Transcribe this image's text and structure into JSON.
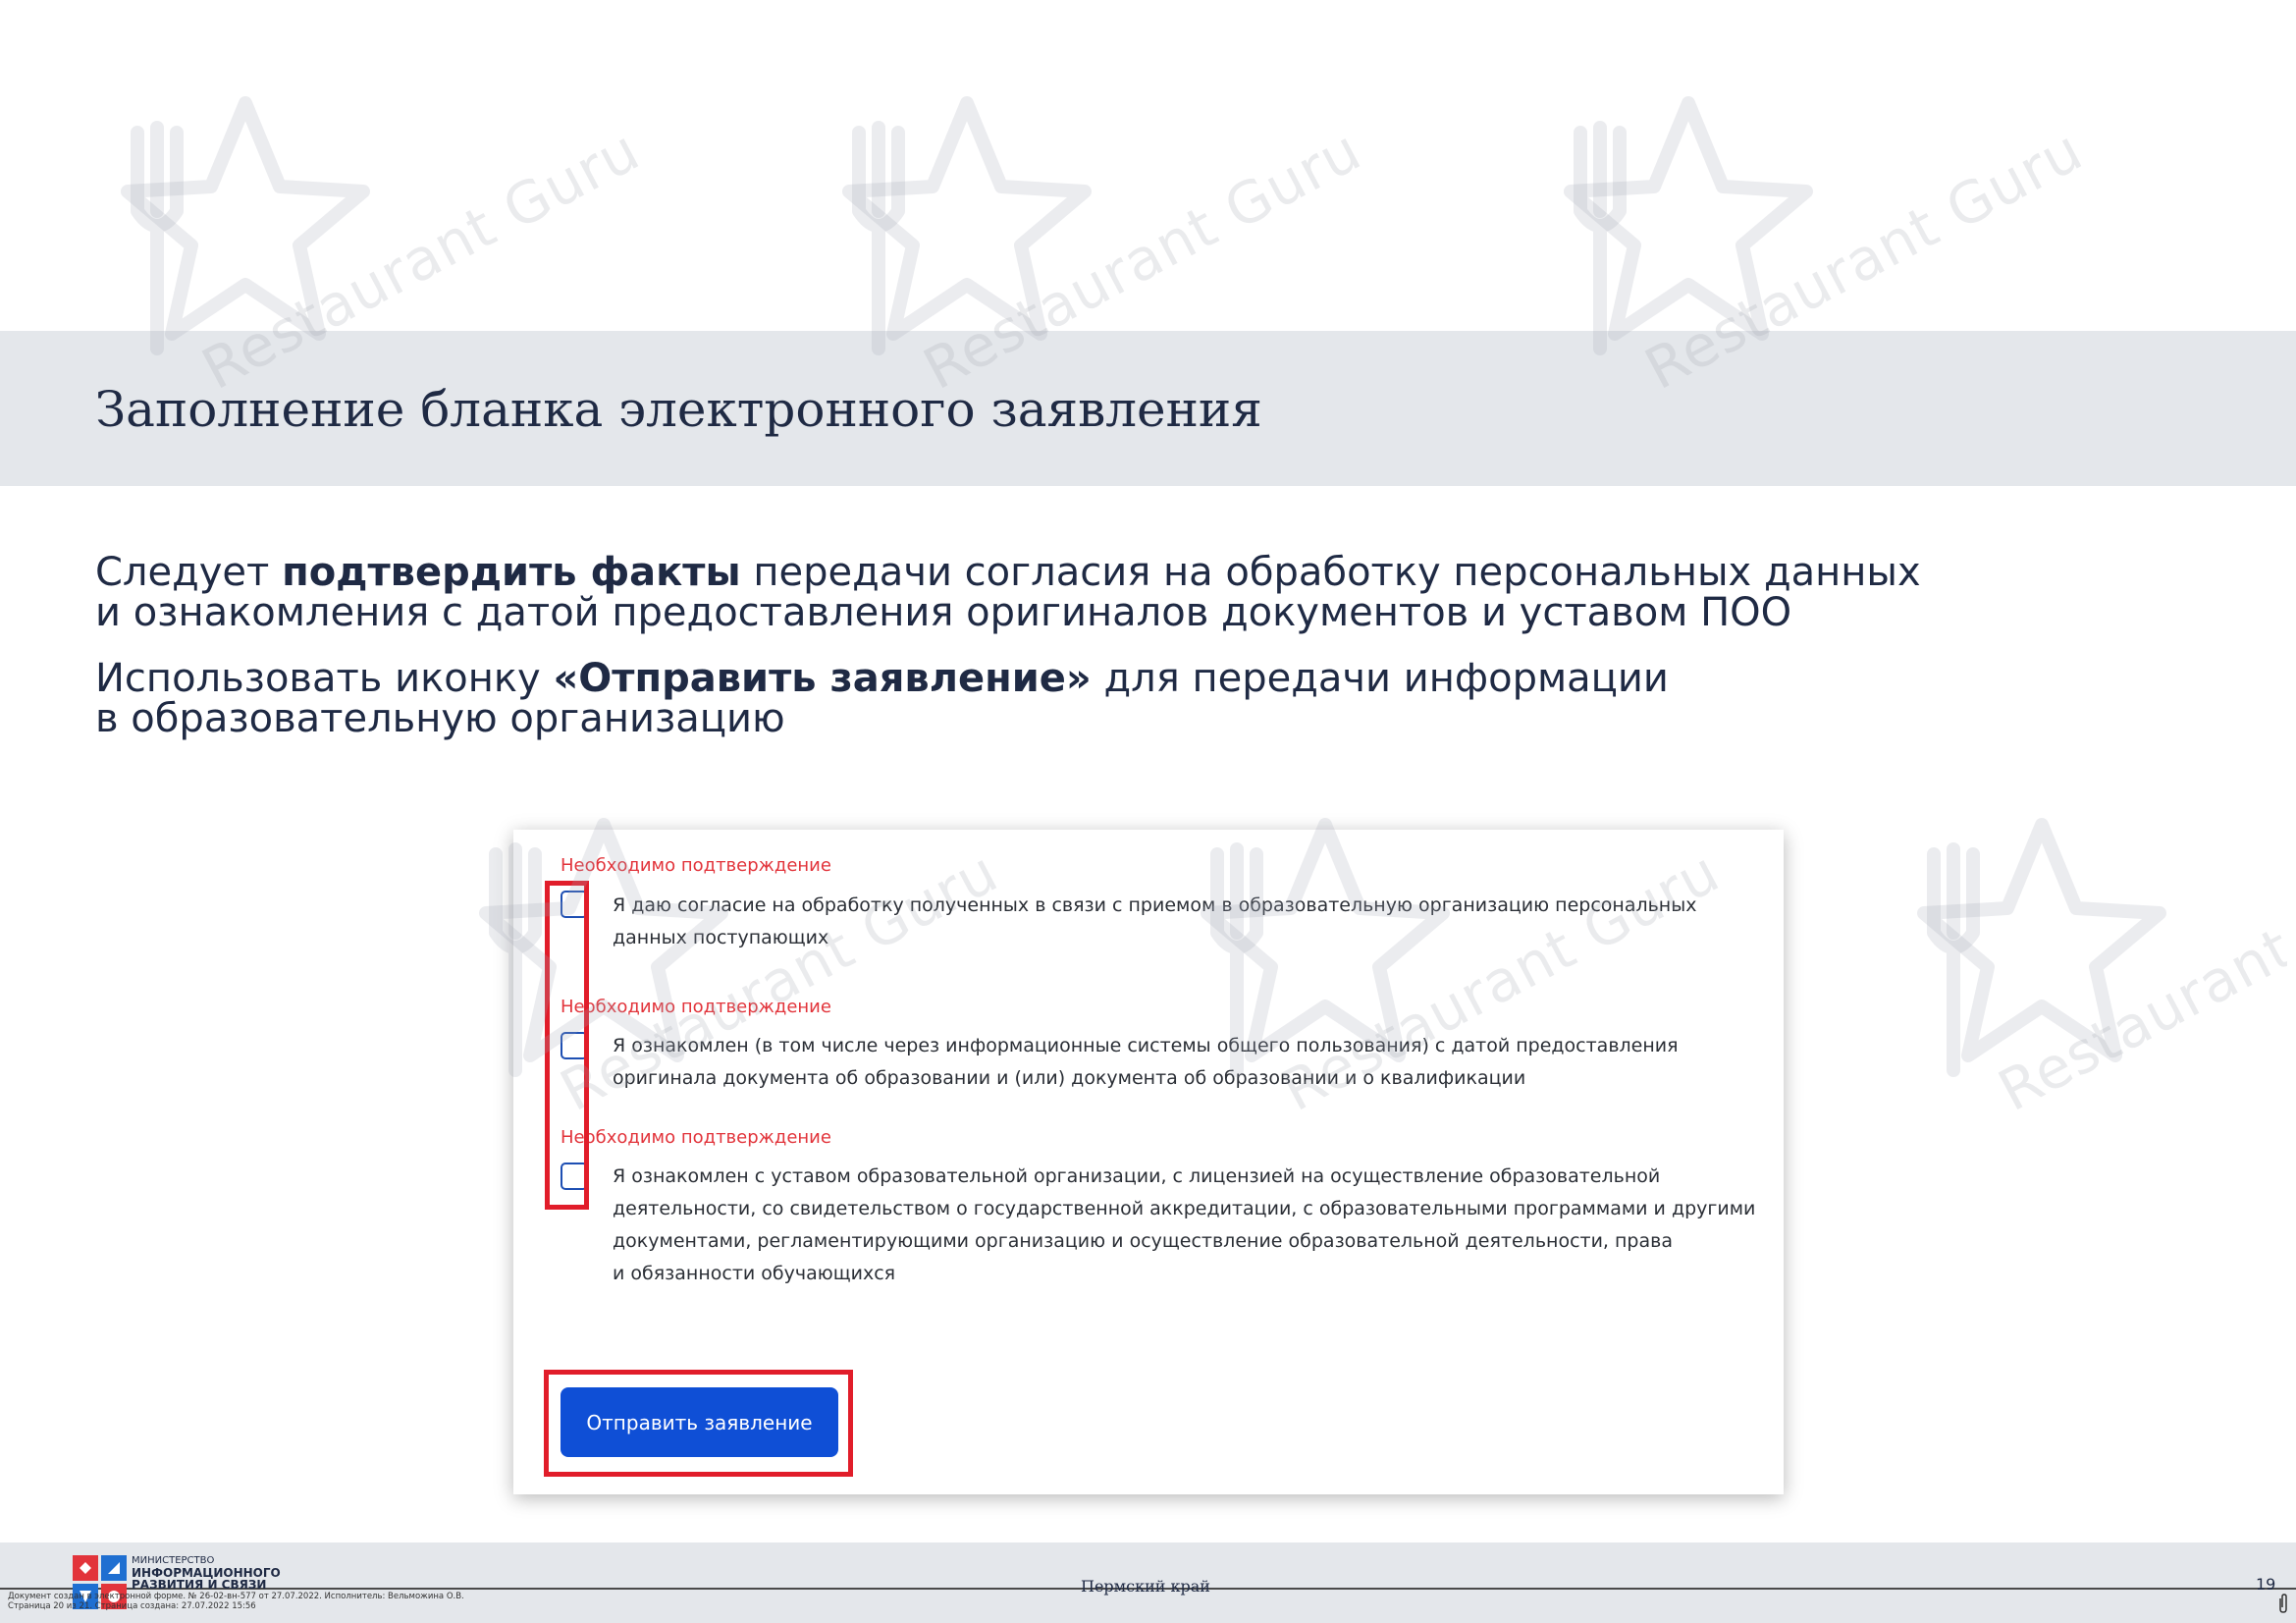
{
  "header": {
    "title": "Заполнение бланка электронного заявления"
  },
  "instructions": {
    "p1_pre": "Следует ",
    "p1_bold": "подтвердить факты",
    "p1_post": " передачи согласия на обработку персональных данных",
    "p1_line2": "и ознакомления с датой предоставления оригиналов документов и уставом ПОО",
    "p2_pre": "Использовать иконку ",
    "p2_bold": "«Отправить заявление»",
    "p2_post": " для передачи информации",
    "p2_line2": "в образовательную организацию"
  },
  "form": {
    "items": [
      {
        "required_label": "Необходимо подтверждение",
        "lines": [
          "Я даю согласие на обработку полученных в связи с приемом в образовательную организацию персональных",
          "данных поступающих"
        ],
        "checked": false
      },
      {
        "required_label": "Необходимо подтверждение",
        "lines": [
          "Я ознакомлен (в том числе через информационные системы общего пользования) с датой предоставления",
          "оригинала документа об образовании и (или) документа об образовании и о квалификации"
        ],
        "checked": false
      },
      {
        "required_label": "Необходимо подтверждение",
        "lines": [
          "Я ознакомлен с уставом образовательной организации, с лицензией на осуществление образовательной",
          "деятельности, со свидетельством о государственной аккредитации, с образовательными программами и другими",
          "документами, регламентирующими организацию и осуществление образовательной деятельности, права",
          "и обязанности обучающихся"
        ],
        "checked": false
      }
    ],
    "submit_label": "Отправить заявление"
  },
  "footer": {
    "ministry_line1": "МИНИСТЕРСТВО",
    "ministry_line2": "ИНФОРМАЦИОННОГО",
    "ministry_line3": "РАЗВИТИЯ И СВЯЗИ",
    "region": "Пермский край",
    "page_number": "19",
    "doc_note_line1": "Документ создан в электронной форме. № 26-02-вн-577 от 27.07.2022. Исполнитель: Вельможина О.В.",
    "doc_note_line2": "Страница 20 из 21. Страница создана: 27.07.2022 15:56"
  },
  "watermark": {
    "text": "Restaurant Guru"
  },
  "colors": {
    "title_band": "#e4e7eb",
    "text_dark": "#1f2a44",
    "required_red": "#e2343b",
    "highlight_red": "#e11d2a",
    "button_blue": "#0f4fd6",
    "checkbox_blue": "#1e4fb3"
  },
  "icons": {
    "logo": "ministry-emblem-icon",
    "watermark": "restaurant-guru-star-fork-icon",
    "attachment": "paperclip-icon"
  }
}
